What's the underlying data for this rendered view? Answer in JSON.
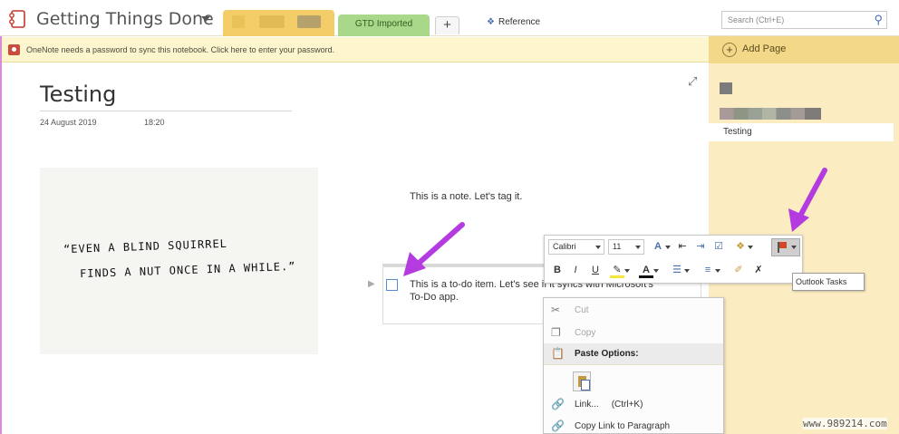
{
  "header": {
    "notebook_title": "Getting Things Done",
    "section_tab": "GTD Imported",
    "add_section": "+",
    "reference_label": "Reference",
    "search_placeholder": "Search (Ctrl+E)",
    "colors": {
      "section_group": "#f3cd67",
      "section_tab": "#a9d88a"
    }
  },
  "infobar": {
    "message": "OneNote needs a password to sync this notebook. Click here to enter your password."
  },
  "pages_pane": {
    "add_page_label": "Add Page",
    "pages": [
      "Testing"
    ]
  },
  "page": {
    "title": "Testing",
    "date": "24 August 2019",
    "time": "18:20",
    "image_text_line1": "“EVEN A BLIND SQUIRREL",
    "image_text_line2": "FINDS A NUT ONCE IN A WHILE.”",
    "note": "This is a note. Let's tag it.",
    "todo_text": "This is a to-do item. Let's see if it syncs with Microsoft's To-Do app."
  },
  "mini_toolbar": {
    "font": "Calibri",
    "size": "11",
    "tooltip": "Outlook Tasks"
  },
  "context_menu": {
    "items": [
      {
        "label": "Cut",
        "icon": "scissors-icon",
        "enabled": false
      },
      {
        "label": "Copy",
        "icon": "copy-icon",
        "enabled": false
      },
      {
        "label": "Paste Options:",
        "icon": "paste-icon",
        "enabled": true
      },
      {
        "label": "Link...",
        "shortcut": "(Ctrl+K)",
        "icon": "link-icon",
        "enabled": true
      },
      {
        "label": "Copy Link to Paragraph",
        "icon": "link-paragraph-icon",
        "enabled": true
      }
    ]
  },
  "watermark": "www.989214.com"
}
